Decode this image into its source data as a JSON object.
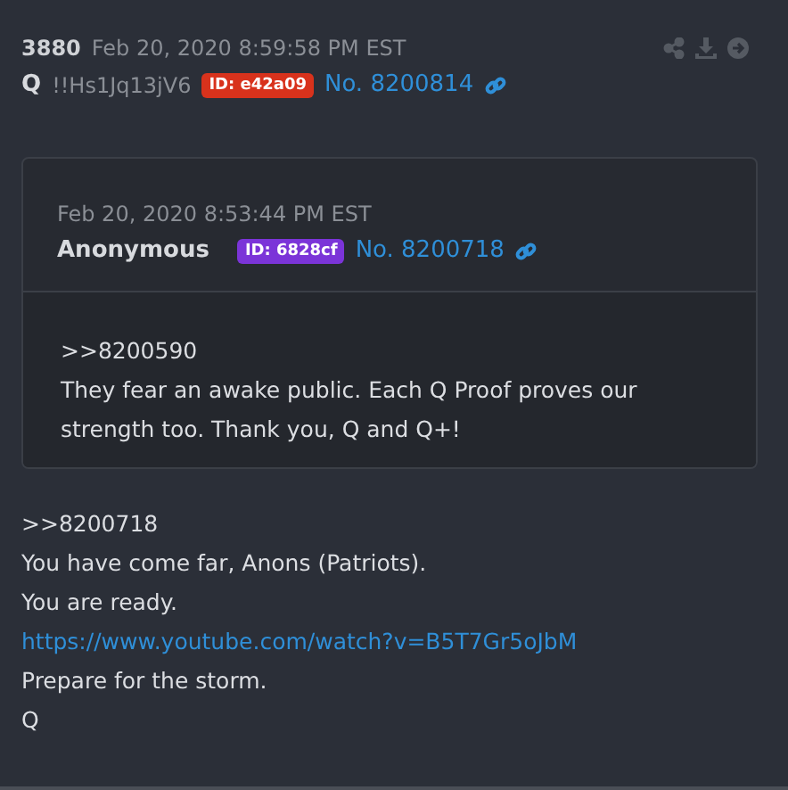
{
  "post": {
    "number": "3880",
    "date": "Feb 20, 2020 8:59:58 PM EST",
    "name": "Q",
    "tripcode": "!!Hs1Jq13jV6",
    "id_badge": "ID: e42a09",
    "post_no": "No. 8200814"
  },
  "quote": {
    "date": "Feb 20, 2020 8:53:44 PM EST",
    "name": "Anonymous",
    "id_badge": "ID: 6828cf",
    "post_no": "No. 8200718",
    "lines": [
      {
        "kind": "text",
        "text": ">>8200590"
      },
      {
        "kind": "text",
        "text": "They fear an awake public. Each Q Proof proves our strength too. Thank you, Q and Q+!"
      }
    ]
  },
  "body": [
    {
      "kind": "text",
      "text": ">>8200718"
    },
    {
      "kind": "text",
      "text": "You have come far, Anons (Patriots)."
    },
    {
      "kind": "text",
      "text": "You are ready."
    },
    {
      "kind": "link",
      "text": "https://www.youtube.com/watch?v=B5T7Gr5oJbM"
    },
    {
      "kind": "text",
      "text": "Prepare for the storm."
    },
    {
      "kind": "text",
      "text": "Q"
    }
  ]
}
